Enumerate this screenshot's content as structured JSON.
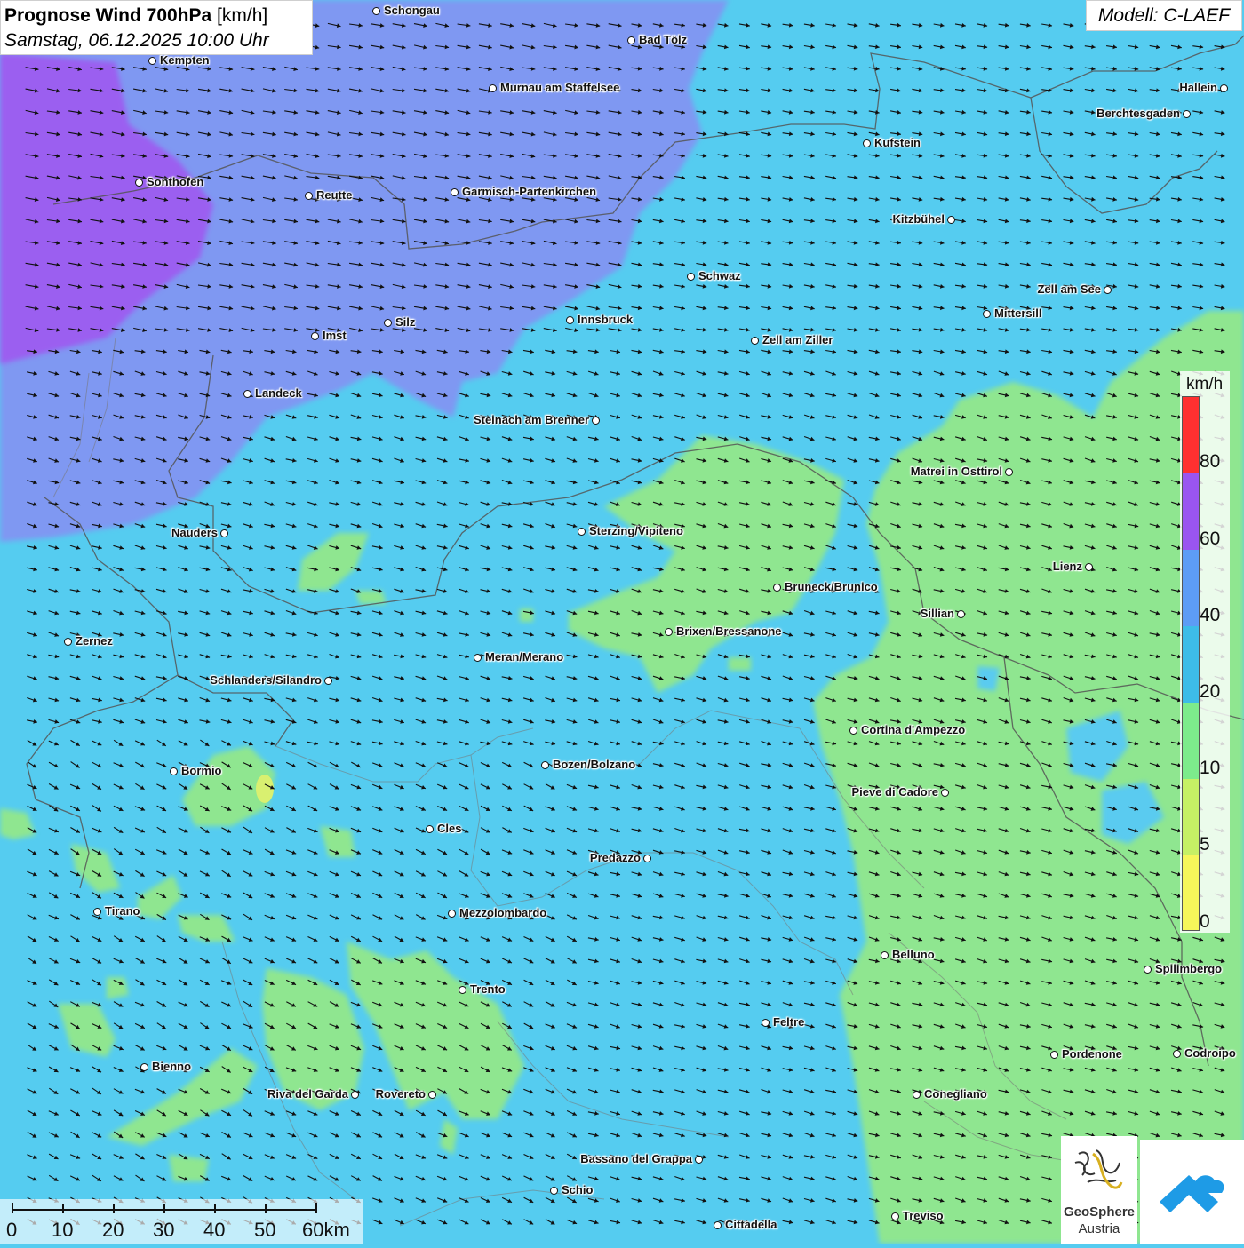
{
  "header": {
    "title_bold": "Prognose Wind 700hPa",
    "title_unit": "[km/h]",
    "datetime": "Samstag, 06.12.2025 10:00 Uhr"
  },
  "model": {
    "label": "Modell: C-LAEF"
  },
  "legend": {
    "unit": "km/h",
    "ticks": [
      "80",
      "60",
      "40",
      "20",
      "10",
      "5",
      "0"
    ],
    "colors": [
      "#ff3030",
      "#9a55f0",
      "#5d9cf5",
      "#3dbce8",
      "#7deb8c",
      "#c6f065",
      "#f6f65a"
    ]
  },
  "colors": {
    "base": "#55ccf0",
    "purple_zone": "#9a5ef0",
    "violet_zone": "#8890f0",
    "green_zone": "#8ee690",
    "yellow_green": "#d8f070",
    "border": "#555555"
  },
  "cities": [
    {
      "name": "Schongau"
    },
    {
      "name": "Bad Tölz"
    },
    {
      "name": "Kempten"
    },
    {
      "name": "Murnau am Staffelsee"
    },
    {
      "name": "Hallein"
    },
    {
      "name": "Berchtesgaden"
    },
    {
      "name": "Kufstein"
    },
    {
      "name": "Sonthofen"
    },
    {
      "name": "Reutte"
    },
    {
      "name": "Garmisch-Partenkirchen"
    },
    {
      "name": "Kitzbühel"
    },
    {
      "name": "Schwaz"
    },
    {
      "name": "Zell am See"
    },
    {
      "name": "Mittersill"
    },
    {
      "name": "Innsbruck"
    },
    {
      "name": "Silz"
    },
    {
      "name": "Imst"
    },
    {
      "name": "Zell am Ziller"
    },
    {
      "name": "Landeck"
    },
    {
      "name": "Steinach am Brenner"
    },
    {
      "name": "Matrei in Osttirol"
    },
    {
      "name": "Nauders"
    },
    {
      "name": "Sterzing/Vipiteno"
    },
    {
      "name": "Lienz"
    },
    {
      "name": "Bruneck/Brunico"
    },
    {
      "name": "Sillian"
    },
    {
      "name": "Brixen/Bressanone"
    },
    {
      "name": "Zernez"
    },
    {
      "name": "Meran/Merano"
    },
    {
      "name": "Schlanders/Silandro"
    },
    {
      "name": "Cortina d'Ampezzo"
    },
    {
      "name": "Bozen/Bolzano"
    },
    {
      "name": "Bormio"
    },
    {
      "name": "Pieve di Cadore"
    },
    {
      "name": "Cles"
    },
    {
      "name": "Predazzo"
    },
    {
      "name": "Tirano"
    },
    {
      "name": "Mezzolombardo"
    },
    {
      "name": "Belluno"
    },
    {
      "name": "Spilimbergo"
    },
    {
      "name": "Trento"
    },
    {
      "name": "Feltre"
    },
    {
      "name": "Bienno"
    },
    {
      "name": "Pordenone"
    },
    {
      "name": "Codroipo"
    },
    {
      "name": "Riva del Garda"
    },
    {
      "name": "Rovereto"
    },
    {
      "name": "Conegliano"
    },
    {
      "name": "Bassano del Grappa"
    },
    {
      "name": "Schio"
    },
    {
      "name": "Treviso"
    },
    {
      "name": "Cittadella"
    }
  ],
  "scalebar": {
    "labels": [
      "0",
      "10",
      "20",
      "30",
      "40",
      "50",
      "60km"
    ]
  },
  "logo": {
    "name": "GeoSphere",
    "sub": "Austria"
  }
}
